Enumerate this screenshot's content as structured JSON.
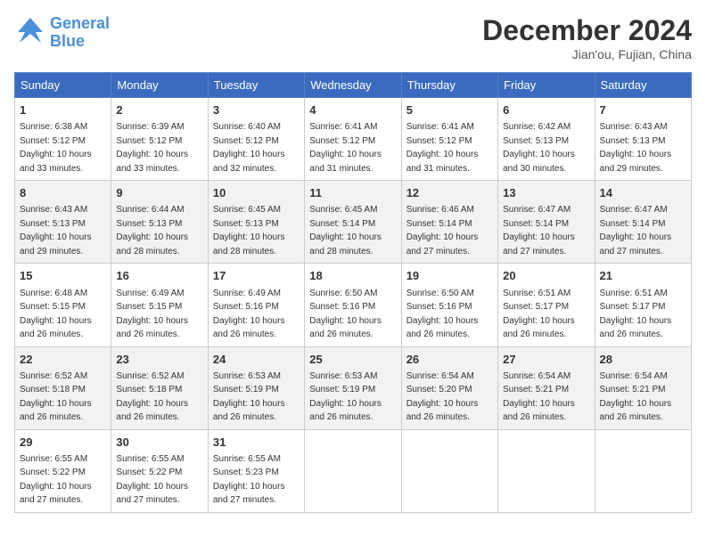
{
  "header": {
    "logo_line1": "General",
    "logo_line2": "Blue",
    "month_title": "December 2024",
    "location": "Jian'ou, Fujian, China"
  },
  "weekdays": [
    "Sunday",
    "Monday",
    "Tuesday",
    "Wednesday",
    "Thursday",
    "Friday",
    "Saturday"
  ],
  "weeks": [
    [
      {
        "day": "1",
        "sunrise": "6:38 AM",
        "sunset": "5:12 PM",
        "daylight": "10 hours and 33 minutes."
      },
      {
        "day": "2",
        "sunrise": "6:39 AM",
        "sunset": "5:12 PM",
        "daylight": "10 hours and 33 minutes."
      },
      {
        "day": "3",
        "sunrise": "6:40 AM",
        "sunset": "5:12 PM",
        "daylight": "10 hours and 32 minutes."
      },
      {
        "day": "4",
        "sunrise": "6:41 AM",
        "sunset": "5:12 PM",
        "daylight": "10 hours and 31 minutes."
      },
      {
        "day": "5",
        "sunrise": "6:41 AM",
        "sunset": "5:12 PM",
        "daylight": "10 hours and 31 minutes."
      },
      {
        "day": "6",
        "sunrise": "6:42 AM",
        "sunset": "5:13 PM",
        "daylight": "10 hours and 30 minutes."
      },
      {
        "day": "7",
        "sunrise": "6:43 AM",
        "sunset": "5:13 PM",
        "daylight": "10 hours and 29 minutes."
      }
    ],
    [
      {
        "day": "8",
        "sunrise": "6:43 AM",
        "sunset": "5:13 PM",
        "daylight": "10 hours and 29 minutes."
      },
      {
        "day": "9",
        "sunrise": "6:44 AM",
        "sunset": "5:13 PM",
        "daylight": "10 hours and 28 minutes."
      },
      {
        "day": "10",
        "sunrise": "6:45 AM",
        "sunset": "5:13 PM",
        "daylight": "10 hours and 28 minutes."
      },
      {
        "day": "11",
        "sunrise": "6:45 AM",
        "sunset": "5:14 PM",
        "daylight": "10 hours and 28 minutes."
      },
      {
        "day": "12",
        "sunrise": "6:46 AM",
        "sunset": "5:14 PM",
        "daylight": "10 hours and 27 minutes."
      },
      {
        "day": "13",
        "sunrise": "6:47 AM",
        "sunset": "5:14 PM",
        "daylight": "10 hours and 27 minutes."
      },
      {
        "day": "14",
        "sunrise": "6:47 AM",
        "sunset": "5:14 PM",
        "daylight": "10 hours and 27 minutes."
      }
    ],
    [
      {
        "day": "15",
        "sunrise": "6:48 AM",
        "sunset": "5:15 PM",
        "daylight": "10 hours and 26 minutes."
      },
      {
        "day": "16",
        "sunrise": "6:49 AM",
        "sunset": "5:15 PM",
        "daylight": "10 hours and 26 minutes."
      },
      {
        "day": "17",
        "sunrise": "6:49 AM",
        "sunset": "5:16 PM",
        "daylight": "10 hours and 26 minutes."
      },
      {
        "day": "18",
        "sunrise": "6:50 AM",
        "sunset": "5:16 PM",
        "daylight": "10 hours and 26 minutes."
      },
      {
        "day": "19",
        "sunrise": "6:50 AM",
        "sunset": "5:16 PM",
        "daylight": "10 hours and 26 minutes."
      },
      {
        "day": "20",
        "sunrise": "6:51 AM",
        "sunset": "5:17 PM",
        "daylight": "10 hours and 26 minutes."
      },
      {
        "day": "21",
        "sunrise": "6:51 AM",
        "sunset": "5:17 PM",
        "daylight": "10 hours and 26 minutes."
      }
    ],
    [
      {
        "day": "22",
        "sunrise": "6:52 AM",
        "sunset": "5:18 PM",
        "daylight": "10 hours and 26 minutes."
      },
      {
        "day": "23",
        "sunrise": "6:52 AM",
        "sunset": "5:18 PM",
        "daylight": "10 hours and 26 minutes."
      },
      {
        "day": "24",
        "sunrise": "6:53 AM",
        "sunset": "5:19 PM",
        "daylight": "10 hours and 26 minutes."
      },
      {
        "day": "25",
        "sunrise": "6:53 AM",
        "sunset": "5:19 PM",
        "daylight": "10 hours and 26 minutes."
      },
      {
        "day": "26",
        "sunrise": "6:54 AM",
        "sunset": "5:20 PM",
        "daylight": "10 hours and 26 minutes."
      },
      {
        "day": "27",
        "sunrise": "6:54 AM",
        "sunset": "5:21 PM",
        "daylight": "10 hours and 26 minutes."
      },
      {
        "day": "28",
        "sunrise": "6:54 AM",
        "sunset": "5:21 PM",
        "daylight": "10 hours and 26 minutes."
      }
    ],
    [
      {
        "day": "29",
        "sunrise": "6:55 AM",
        "sunset": "5:22 PM",
        "daylight": "10 hours and 27 minutes."
      },
      {
        "day": "30",
        "sunrise": "6:55 AM",
        "sunset": "5:22 PM",
        "daylight": "10 hours and 27 minutes."
      },
      {
        "day": "31",
        "sunrise": "6:55 AM",
        "sunset": "5:23 PM",
        "daylight": "10 hours and 27 minutes."
      },
      null,
      null,
      null,
      null
    ]
  ]
}
